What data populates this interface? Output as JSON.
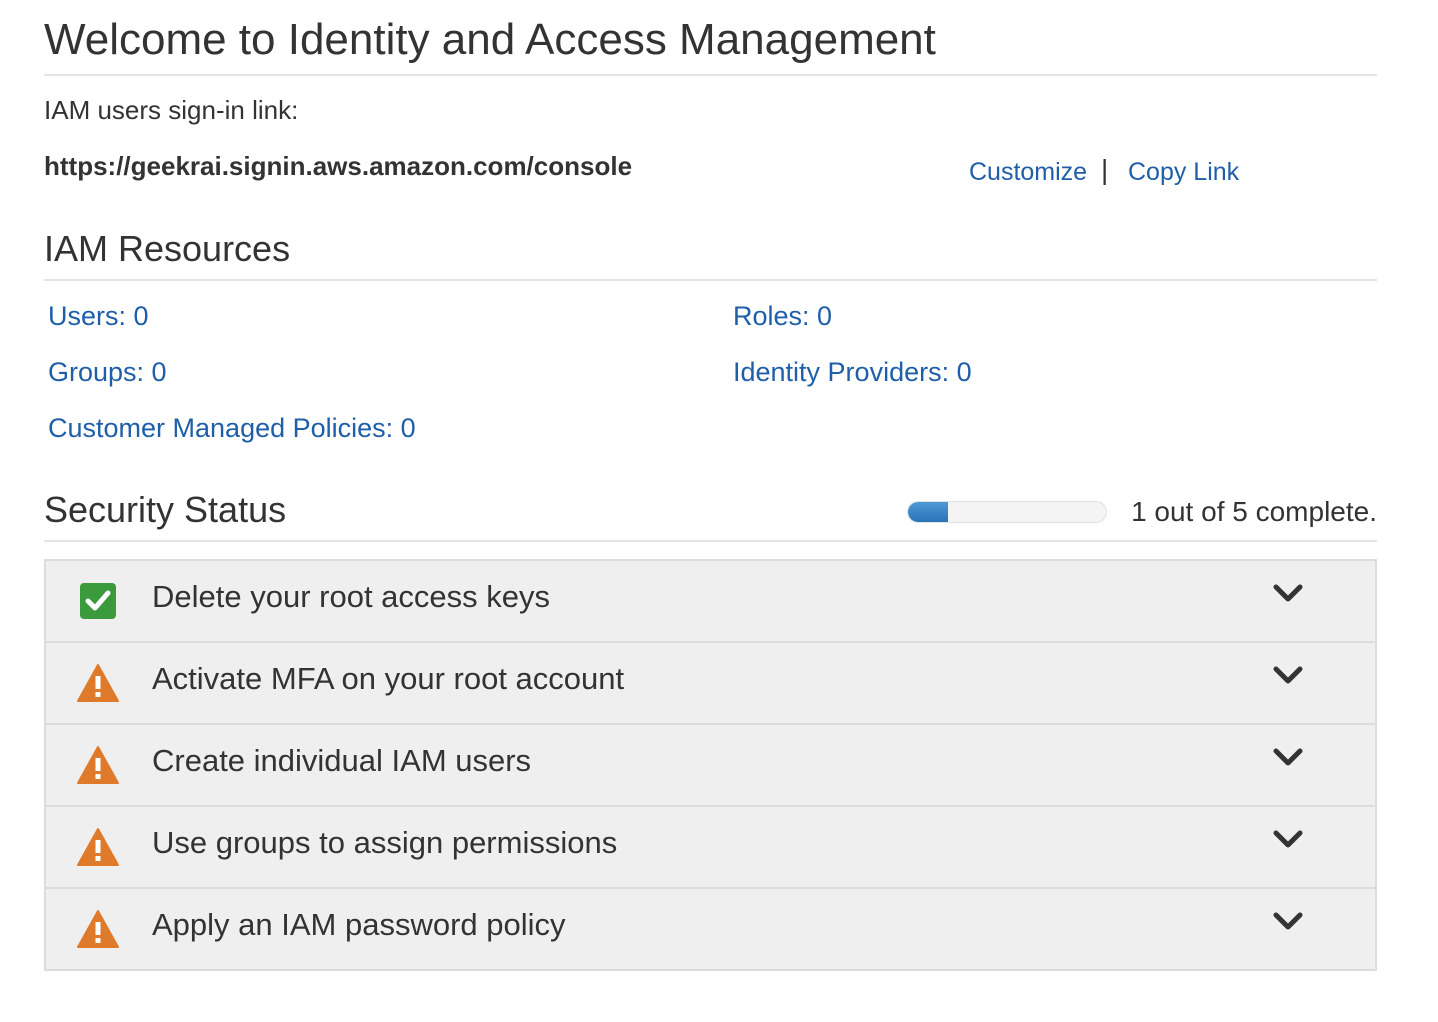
{
  "header": {
    "title": "Welcome to Identity and Access Management"
  },
  "signin": {
    "label": "IAM users sign-in link:",
    "url": "https://geekrai.signin.aws.amazon.com/console",
    "customize_label": "Customize",
    "separator": "|",
    "copy_link_label": "Copy Link"
  },
  "resources": {
    "title": "IAM Resources",
    "users": "Users: 0",
    "groups": "Groups: 0",
    "policies": "Customer Managed Policies: 0",
    "roles": "Roles: 0",
    "identity_providers": "Identity Providers: 0"
  },
  "security": {
    "title": "Security Status",
    "progress_fraction": 0.2,
    "progress_text": "1 out of 5 complete.",
    "items": [
      {
        "label": "Delete your root access keys",
        "status": "complete",
        "icon": "check-icon"
      },
      {
        "label": "Activate MFA on your root account",
        "status": "warning",
        "icon": "warning-icon"
      },
      {
        "label": "Create individual IAM users",
        "status": "warning",
        "icon": "warning-icon"
      },
      {
        "label": "Use groups to assign permissions",
        "status": "warning",
        "icon": "warning-icon"
      },
      {
        "label": "Apply an IAM password policy",
        "status": "warning",
        "icon": "warning-icon"
      }
    ]
  },
  "colors": {
    "link": "#1f5ea8",
    "complete": "#3a9a3c",
    "warning": "#e07a2b",
    "progress": "#2a73b8"
  }
}
